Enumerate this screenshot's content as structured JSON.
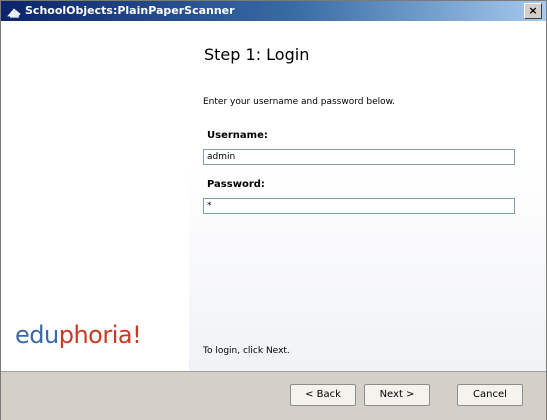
{
  "window": {
    "title": "SchoolObjects:PlainPaperScanner",
    "close_label": "×"
  },
  "sidebar": {
    "logo_part1": "edu",
    "logo_part2": "phoria!"
  },
  "main": {
    "step_title": "Step 1: Login",
    "instructions": "Enter your username and password below.",
    "username_label": "Username:",
    "username_value": "admin",
    "password_label": "Password:",
    "password_value": "*",
    "footer_hint": "To login, click Next."
  },
  "buttons": {
    "back": "< Back",
    "next": "Next >",
    "cancel": "Cancel"
  },
  "colors": {
    "titlebar_start": "#0a246a",
    "logo_blue": "#3b6aa8",
    "logo_red": "#c93a24",
    "dialog_gray": "#d4d0c8"
  }
}
